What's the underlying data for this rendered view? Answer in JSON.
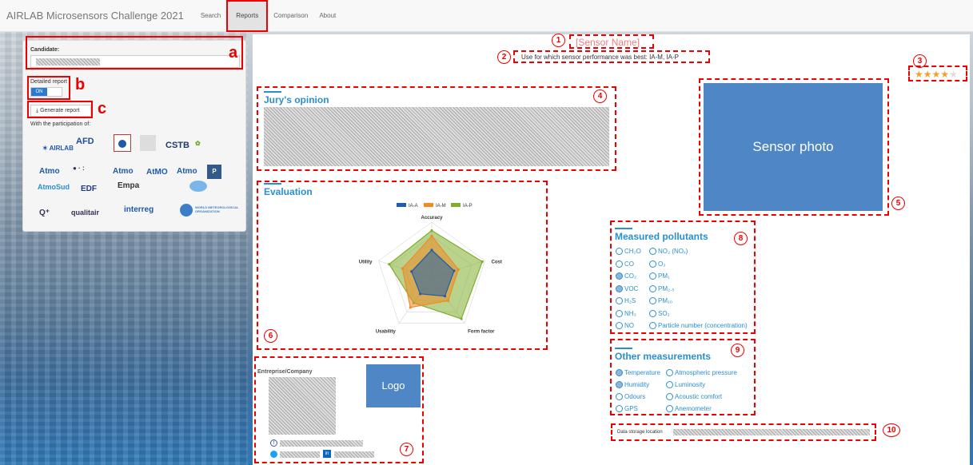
{
  "navbar": {
    "brand": "AIRLAB Microsensors Challenge 2021",
    "tabs": [
      "Search",
      "Reports",
      "Comparison",
      "About"
    ]
  },
  "sidebar": {
    "candidate_label": "Candidate:",
    "detailed_label": "Detailed report",
    "toggle_on": "ON",
    "generate_label": "Generate report",
    "participation": "With the participation of:"
  },
  "annotations": {
    "a": "a",
    "b": "b",
    "c": "c",
    "n1": "1",
    "n2": "2",
    "n3": "3",
    "n4": "4",
    "n5": "5",
    "n6": "6",
    "n7": "7",
    "n8": "8",
    "n9": "9",
    "n10": "10"
  },
  "logos": [
    "AFD",
    "ADEME",
    "Atmo France",
    "CSTB",
    "Atmo",
    "Atmo",
    "AtMO",
    "Atmo",
    "AtmoSud",
    "EDF",
    "Empa",
    "qualitair",
    "interreg",
    "WORLD METEOROLOGICAL ORGANIZATION"
  ],
  "header": {
    "sensor_name": "[Sensor Name]",
    "best_use": "Use for which sensor performance was best: IA-M, IA-P"
  },
  "rating": {
    "stars": 4,
    "max": 5
  },
  "jury": {
    "title": "Jury's opinion"
  },
  "photo": {
    "text": "Sensor photo"
  },
  "evaluation": {
    "title": "Evaluation"
  },
  "chart_data": {
    "type": "radar",
    "axes": [
      "Accuracy",
      "Cost",
      "Form factor",
      "Usability",
      "Utility"
    ],
    "series": [
      {
        "name": "IA-A",
        "color": "#1f5fa8",
        "values": [
          0.5,
          0.42,
          0.4,
          0.35,
          0.38
        ]
      },
      {
        "name": "IA-M",
        "color": "#f08a24",
        "values": [
          0.75,
          0.5,
          0.5,
          0.65,
          0.55
        ]
      },
      {
        "name": "IA-P",
        "color": "#7fae2e",
        "values": [
          0.85,
          0.95,
          0.9,
          0.55,
          0.8
        ]
      }
    ]
  },
  "company": {
    "title": "Entreprise/Company",
    "logo": "Logo"
  },
  "pollutants": {
    "title": "Measured pollutants",
    "items": [
      {
        "label": "CH₂O",
        "checked": false
      },
      {
        "label": "NO₂ (NOₓ)",
        "checked": false
      },
      {
        "label": "CO",
        "checked": false
      },
      {
        "label": "O₃",
        "checked": false
      },
      {
        "label": "CO₂",
        "checked": true
      },
      {
        "label": "PM₁",
        "checked": false
      },
      {
        "label": "VOC",
        "checked": true
      },
      {
        "label": "PM₂.₅",
        "checked": false
      },
      {
        "label": "H₂S",
        "checked": false
      },
      {
        "label": "PM₁₀",
        "checked": false
      },
      {
        "label": "NH₃",
        "checked": false
      },
      {
        "label": "SO₂",
        "checked": false
      },
      {
        "label": "NO",
        "checked": false
      },
      {
        "label": "Particle number (concentration)",
        "checked": false
      }
    ]
  },
  "other": {
    "title": "Other measurements",
    "items": [
      {
        "label": "Temperature",
        "checked": true
      },
      {
        "label": "Atmospheric pressure",
        "checked": false
      },
      {
        "label": "Humidity",
        "checked": true
      },
      {
        "label": "Luminosity",
        "checked": false
      },
      {
        "label": "Odours",
        "checked": false
      },
      {
        "label": "Acoustic comfort",
        "checked": false
      },
      {
        "label": "GPS",
        "checked": false
      },
      {
        "label": "Anemometer",
        "checked": false
      }
    ]
  },
  "storage": {
    "label": "Data storage location"
  }
}
